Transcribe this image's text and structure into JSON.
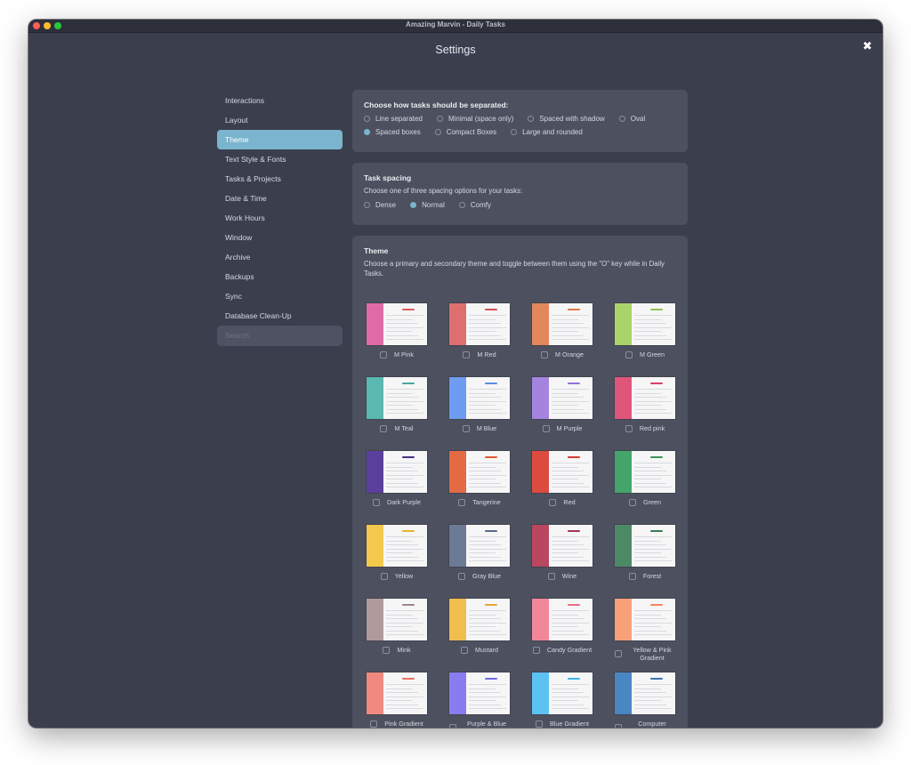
{
  "window": {
    "title": "Amazing Marvin - Daily Tasks"
  },
  "header": {
    "title": "Settings",
    "close_label": "✖"
  },
  "sidebar": {
    "items": [
      {
        "label": "Interactions",
        "active": false
      },
      {
        "label": "Layout",
        "active": false
      },
      {
        "label": "Theme",
        "active": true
      },
      {
        "label": "Text Style & Fonts",
        "active": false
      },
      {
        "label": "Tasks & Projects",
        "active": false
      },
      {
        "label": "Date & Time",
        "active": false
      },
      {
        "label": "Work Hours",
        "active": false
      },
      {
        "label": "Window",
        "active": false
      },
      {
        "label": "Archive",
        "active": false
      },
      {
        "label": "Backups",
        "active": false
      },
      {
        "label": "Sync",
        "active": false
      },
      {
        "label": "Database Clean-Up",
        "active": false
      }
    ],
    "search_placeholder": "Search"
  },
  "separation": {
    "title": "Choose how tasks should be separated:",
    "options": [
      {
        "label": "Line separated",
        "checked": false
      },
      {
        "label": "Minimal (space only)",
        "checked": false
      },
      {
        "label": "Spaced with shadow",
        "checked": false
      },
      {
        "label": "Oval",
        "checked": false
      },
      {
        "label": "Spaced boxes",
        "checked": true
      },
      {
        "label": "Compact Boxes",
        "checked": false
      },
      {
        "label": "Large and rounded",
        "checked": false
      }
    ]
  },
  "spacing": {
    "title": "Task spacing",
    "description": "Choose one of three spacing options for your tasks:",
    "options": [
      {
        "label": "Dense",
        "checked": false
      },
      {
        "label": "Normal",
        "checked": true
      },
      {
        "label": "Comfy",
        "checked": false
      }
    ]
  },
  "theme": {
    "title": "Theme",
    "description": "Choose a primary and secondary theme and toggle between them using the \"O\" key while in Daily Tasks.",
    "themes": [
      {
        "label": "M Pink",
        "color": "#e06aa6",
        "accent": "#e05a5a"
      },
      {
        "label": "M Red",
        "color": "#df6f6f",
        "accent": "#d94f4f"
      },
      {
        "label": "M Orange",
        "color": "#e3875c",
        "accent": "#e07a45"
      },
      {
        "label": "M Green",
        "color": "#a9d46a",
        "accent": "#8fc24d"
      },
      {
        "label": "M Teal",
        "color": "#5bb8b0",
        "accent": "#4aa8a0"
      },
      {
        "label": "M Blue",
        "color": "#6d9cf0",
        "accent": "#5a8ce8"
      },
      {
        "label": "M Purple",
        "color": "#a584e0",
        "accent": "#9370db"
      },
      {
        "label": "Red pink",
        "color": "#e0567a",
        "accent": "#d84068"
      },
      {
        "label": "Dark Purple",
        "color": "#5b3f9c",
        "accent": "#4a3185"
      },
      {
        "label": "Tangerine",
        "color": "#e46a44",
        "accent": "#df5a30"
      },
      {
        "label": "Red",
        "color": "#dd4a3f",
        "accent": "#d23a2e"
      },
      {
        "label": "Green",
        "color": "#43a56a",
        "accent": "#389658"
      },
      {
        "label": "Yellow",
        "color": "#f2c94c",
        "accent": "#e8b62a"
      },
      {
        "label": "Gray Blue",
        "color": "#6c7a96",
        "accent": "#5a6a88"
      },
      {
        "label": "Wine",
        "color": "#b8475f",
        "accent": "#a2364e"
      },
      {
        "label": "Forest",
        "color": "#4c8a66",
        "accent": "#3d7a56"
      },
      {
        "label": "Mink",
        "color": "#b09a9c",
        "accent": "#9e8789"
      },
      {
        "label": "Mustard",
        "color": "#f0bd4f",
        "accent": "#e4aa34"
      },
      {
        "label": "Candy Gradient",
        "color": "#f2879a",
        "accent": "#ee6e86"
      },
      {
        "label": "Yellow & Pink Gradient",
        "color": "#f8a179",
        "accent": "#f5845e"
      },
      {
        "label": "Pink Gradient",
        "color": "#f08a80",
        "accent": "#eb6f64"
      },
      {
        "label": "Purple & Blue Gradient",
        "color": "#8a7cf0",
        "accent": "#6f68e6"
      },
      {
        "label": "Blue Gradient",
        "color": "#5cc2f2",
        "accent": "#3db2ec"
      },
      {
        "label": "Computer Gradient",
        "color": "#4a86c2",
        "accent": "#3a74b0"
      }
    ]
  }
}
